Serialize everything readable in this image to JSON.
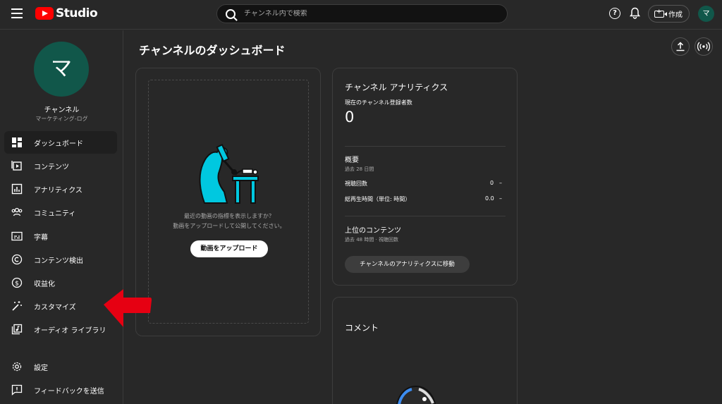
{
  "app": {
    "logo_text": "Studio"
  },
  "search": {
    "placeholder": "チャンネル内で検索"
  },
  "header": {
    "create_label": "作成",
    "avatar_letter": "マ",
    "help_glyph": "?"
  },
  "channel": {
    "avatar_letter": "マ",
    "name": "チャンネル",
    "subtitle": "マーケティング-ログ"
  },
  "sidebar": {
    "items": [
      {
        "label": "ダッシュボード",
        "icon": "dashboard-icon",
        "active": true
      },
      {
        "label": "コンテンツ",
        "icon": "content-icon"
      },
      {
        "label": "アナリティクス",
        "icon": "analytics-icon"
      },
      {
        "label": "コミュニティ",
        "icon": "community-icon"
      },
      {
        "label": "字幕",
        "icon": "subtitles-icon"
      },
      {
        "label": "コンテンツ検出",
        "icon": "copyright-icon"
      },
      {
        "label": "収益化",
        "icon": "dollar-icon"
      },
      {
        "label": "カスタマイズ",
        "icon": "magic-wand-icon"
      },
      {
        "label": "オーディオ ライブラリ",
        "icon": "audio-library-icon"
      }
    ],
    "bottom": [
      {
        "label": "設定",
        "icon": "gear-icon"
      },
      {
        "label": "フィードバックを送信",
        "icon": "feedback-icon"
      }
    ]
  },
  "main": {
    "title": "チャンネルのダッシュボード",
    "upload_card": {
      "line1": "最近の動画の指標を表示しますか？",
      "line2": "動画をアップロードして公開してください。",
      "button": "動画をアップロード"
    },
    "analytics": {
      "title": "チャンネル アナリティクス",
      "subscribers_label": "現在のチャンネル登録者数",
      "subscribers_value": "0",
      "summary_title": "概要",
      "summary_period": "過去 28 日間",
      "views_label": "視聴回数",
      "views_value": "0",
      "views_trend": "–",
      "watch_label": "総再生時間（単位: 時間）",
      "watch_value": "0.0",
      "watch_trend": "–",
      "top_title": "上位のコンテンツ",
      "top_sub": "過去 48 時間 · 視聴回数",
      "go_button": "チャンネルのアナリティクスに移動"
    },
    "comments": {
      "title": "コメント"
    }
  },
  "colors": {
    "accent_avatar": "#11574a",
    "arrow": "#e60012",
    "illustration": "#00c8e0"
  }
}
